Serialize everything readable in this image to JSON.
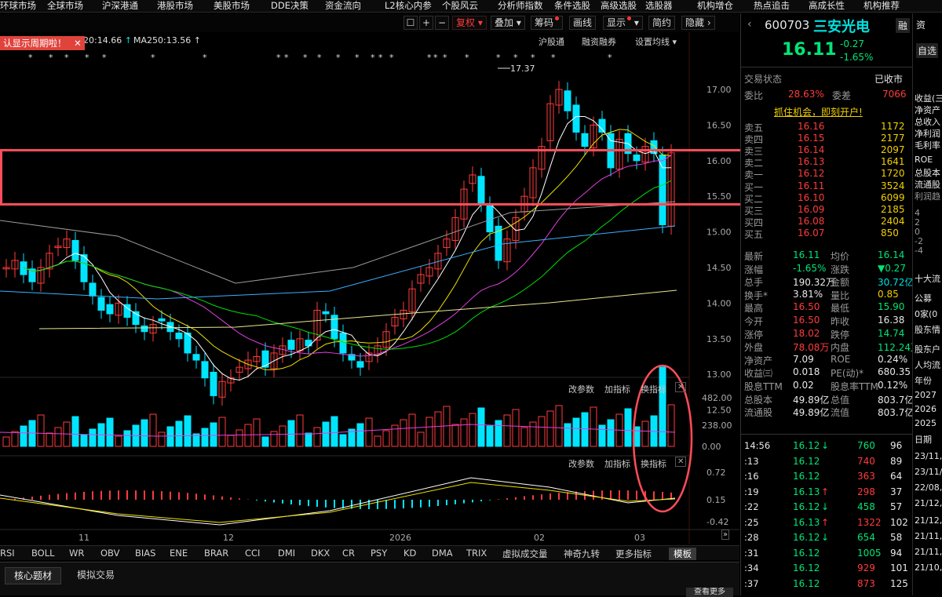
{
  "topnav": [
    "环球市场",
    "全球市场",
    "沪深港通",
    "港股市场",
    "美股市场",
    "DDE决策",
    "资金流向",
    "L2核心内参",
    "个股风云",
    "分析师指数",
    "条件选股",
    "高级选股",
    "选股器",
    "机构增仓",
    "热点追击",
    "高成长性",
    "机构推荐"
  ],
  "toolbar": {
    "plus": "+",
    "minus": "−",
    "fuquan": "复权",
    "diejia": "叠加",
    "chouma": "筹码",
    "huaxian": "画线",
    "xianshi": "显示",
    "jianjie": "简约",
    "yincang": "隐藏"
  },
  "ma": {
    "ma_tail": "20:14.66",
    "ma250": "MA250:13.56"
  },
  "notice": "认显示周期啦！",
  "notice_close": "✕",
  "chart_links": {
    "hgt": "沪股通",
    "rzrq": "融资融券",
    "setma": "设置均线"
  },
  "chart_data": {
    "type": "candlestick",
    "high_label": "17.37",
    "price_ticks": [
      "17.00",
      "16.50",
      "16.00",
      "15.50",
      "15.00",
      "14.50",
      "14.00",
      "13.50",
      "13.00",
      "12.50"
    ],
    "vol_ticks": [
      "482.00",
      "238.00",
      "0.00"
    ],
    "macd_ticks": [
      "0.72",
      "0.15",
      "-0.42"
    ],
    "x_labels": [
      "11",
      "12",
      "2026",
      "02",
      "03"
    ]
  },
  "panel_ctrl": {
    "gai": "改参数",
    "jia": "加指标",
    "huan": "换指标",
    "close": "✕"
  },
  "indicators": [
    "RSI",
    "BOLL",
    "WR",
    "OBV",
    "BIAS",
    "ENE",
    "BRAR",
    "CCI",
    "DMI",
    "DKX",
    "CR",
    "PSY",
    "KD",
    "DMA",
    "TRIX",
    "虚拟成交量",
    "神奇九转",
    "更多指标"
  ],
  "template_btn": "模板",
  "bottom_tabs": [
    "核心题材",
    "模拟交易"
  ],
  "more_btn": "查看更多",
  "stock": {
    "code": "600703",
    "name": "三安光电",
    "price": "16.11",
    "chg": "-0.27",
    "pct": "-1.65%",
    "rong": "融",
    "zixuan": "自选"
  },
  "status": {
    "label": "交易状态",
    "value": "已收市",
    "extra": "资"
  },
  "weibi": {
    "l": "委比",
    "v": "28.63%",
    "l2": "委差",
    "v2": "7066"
  },
  "promo": "抓住机会，即刻开户!",
  "asks": [
    {
      "n": "卖五",
      "p": "16.16",
      "v": "1172"
    },
    {
      "n": "卖四",
      "p": "16.15",
      "v": "2177"
    },
    {
      "n": "卖三",
      "p": "16.14",
      "v": "2097"
    },
    {
      "n": "卖二",
      "p": "16.13",
      "v": "1641"
    },
    {
      "n": "卖一",
      "p": "16.12",
      "v": "1720"
    }
  ],
  "bids": [
    {
      "n": "买一",
      "p": "16.11",
      "v": "3524"
    },
    {
      "n": "买二",
      "p": "16.10",
      "v": "6099"
    },
    {
      "n": "买三",
      "p": "16.09",
      "v": "2185"
    },
    {
      "n": "买四",
      "p": "16.08",
      "v": "2404"
    },
    {
      "n": "买五",
      "p": "16.07",
      "v": "850"
    }
  ],
  "stats": [
    {
      "l1": "最新",
      "v1": "16.11",
      "c1": "grn",
      "l2": "均价",
      "v2": "16.14",
      "c2": "grn"
    },
    {
      "l1": "涨幅",
      "v1": "-1.65%",
      "c1": "grn",
      "l2": "涨跌",
      "v2": "▼0.27",
      "c2": "grn"
    },
    {
      "l1": "总手",
      "v1": "190.32万",
      "c1": "wht",
      "l2": "金额",
      "v2": "30.72亿",
      "c2": "cyan"
    },
    {
      "l1": "换手*",
      "v1": "3.81%",
      "c1": "wht",
      "l2": "量比",
      "v2": "0.85",
      "c2": "yel"
    },
    {
      "l1": "最高",
      "v1": "16.50",
      "c1": "red",
      "l2": "最低",
      "v2": "15.90",
      "c2": "grn"
    },
    {
      "l1": "今开",
      "v1": "16.50",
      "c1": "red",
      "l2": "昨收",
      "v2": "16.38",
      "c2": "wht"
    },
    {
      "l1": "涨停",
      "v1": "18.02",
      "c1": "red",
      "l2": "跌停",
      "v2": "14.74",
      "c2": "grn"
    },
    {
      "l1": "外盘",
      "v1": "78.08万",
      "c1": "red",
      "l2": "内盘",
      "v2": "112.24万",
      "c2": "grn"
    },
    {
      "l1": "净资产",
      "v1": "7.09",
      "c1": "wht",
      "l2": "ROE",
      "v2": "0.24%",
      "c2": "wht"
    },
    {
      "l1": "收益㈢",
      "v1": "0.018",
      "c1": "wht",
      "l2": "PE(动)*",
      "v2": "680.35",
      "c2": "wht"
    },
    {
      "l1": "股息TTM",
      "v1": "0.02",
      "c1": "wht",
      "l2": "股息率TTM",
      "v2": "0.12%",
      "c2": "wht"
    },
    {
      "l1": "总股本",
      "v1": "49.89亿",
      "c1": "wht",
      "l2": "总值",
      "v2": "803.7亿",
      "c2": "wht"
    },
    {
      "l1": "流通股",
      "v1": "49.89亿",
      "c1": "wht",
      "l2": "流值",
      "v2": "803.7亿",
      "c2": "wht"
    }
  ],
  "ticks": [
    {
      "t": "14:56",
      "p": "16.12",
      "a": "↓",
      "v": "760",
      "n": "96",
      "vc": "grn"
    },
    {
      "t": ":13",
      "p": "16.12",
      "a": "",
      "v": "740",
      "n": "89",
      "vc": "red"
    },
    {
      "t": ":16",
      "p": "16.12",
      "a": "",
      "v": "363",
      "n": "64",
      "vc": "red"
    },
    {
      "t": ":19",
      "p": "16.13",
      "a": "↑",
      "v": "298",
      "n": "37",
      "vc": "red"
    },
    {
      "t": ":22",
      "p": "16.12",
      "a": "↓",
      "v": "458",
      "n": "57",
      "vc": "grn"
    },
    {
      "t": ":25",
      "p": "16.13",
      "a": "↑",
      "v": "1322",
      "n": "102",
      "vc": "red"
    },
    {
      "t": ":28",
      "p": "16.12",
      "a": "↓",
      "v": "654",
      "n": "58",
      "vc": "grn"
    },
    {
      "t": ":31",
      "p": "16.12",
      "a": "",
      "v": "1005",
      "n": "94",
      "vc": "grn"
    },
    {
      "t": ":34",
      "p": "16.12",
      "a": "",
      "v": "929",
      "n": "101",
      "vc": "red"
    },
    {
      "t": ":37",
      "p": "16.12",
      "a": "",
      "v": "873",
      "n": "125",
      "vc": "red"
    }
  ],
  "farright": [
    "收益(三",
    "净资产",
    "总收入",
    "净利润",
    "毛利率",
    "ROE",
    "总股本",
    "流通股",
    "利润趋",
    "4",
    "2",
    "0",
    "-2",
    "-4",
    "十大流",
    "公募",
    "0家(0",
    "股东情",
    "股东户",
    "人均流",
    "年份",
    "2027",
    "2026",
    "2025",
    "日期",
    "23/11,",
    "23/11/",
    "22/08,",
    "21/12,",
    "21/12,",
    "21/11,",
    "21/11,",
    "21/10,"
  ]
}
